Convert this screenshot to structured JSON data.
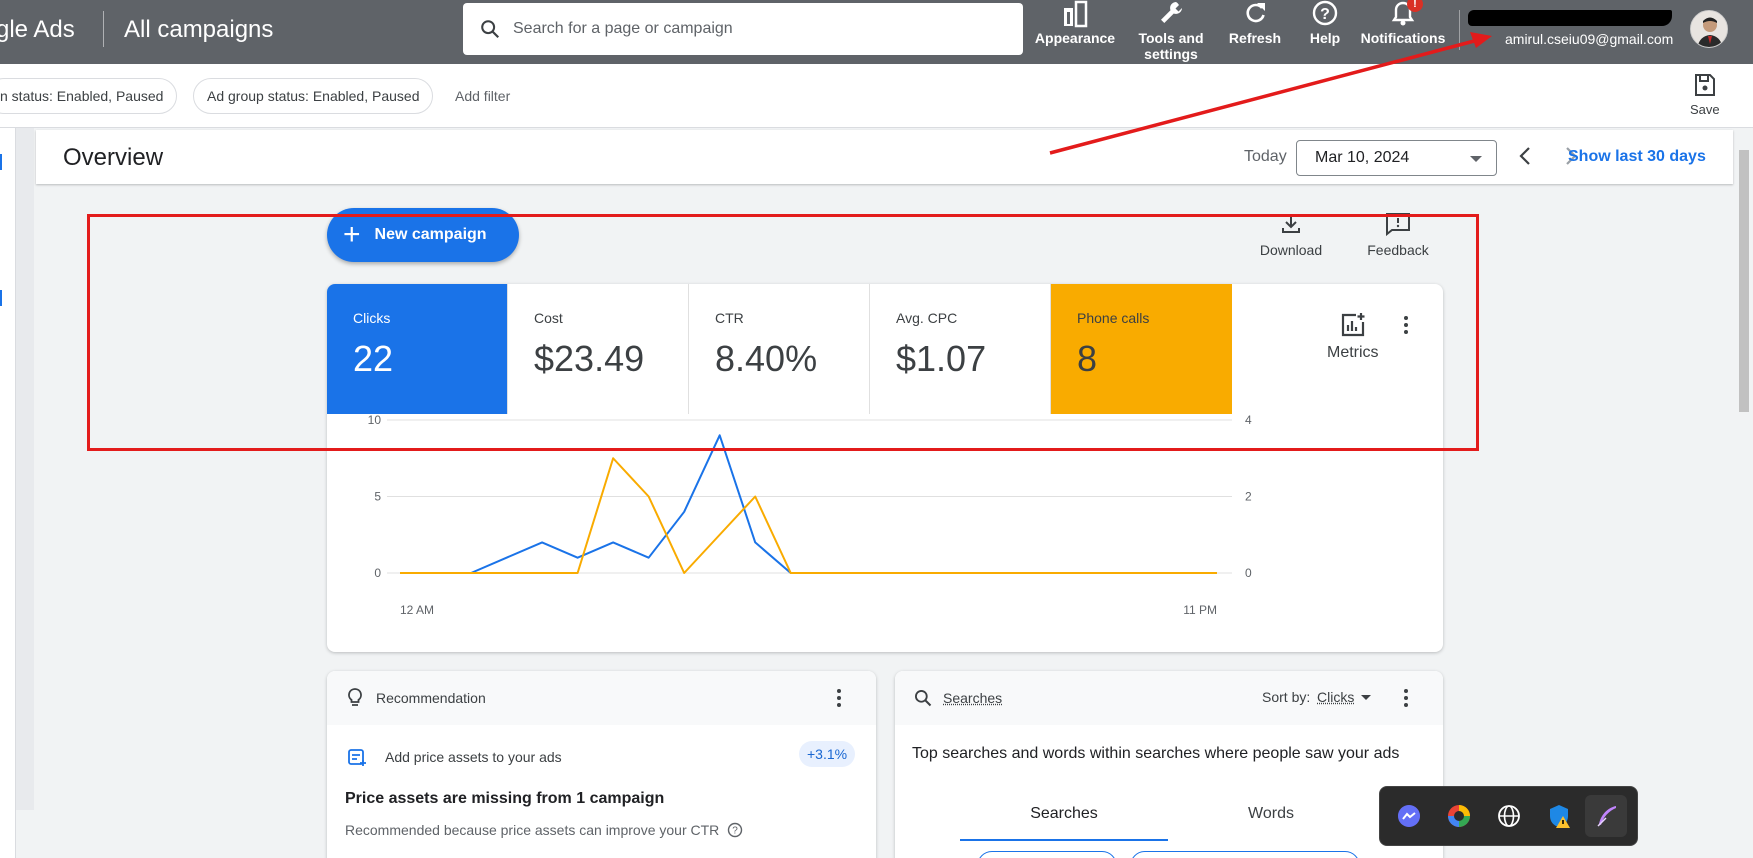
{
  "header": {
    "brand": "gle Ads",
    "page_title": "All campaigns",
    "search_placeholder": "Search for a page or campaign",
    "actions": {
      "appearance": "Appearance",
      "tools_line1": "Tools and",
      "tools_line2": "settings",
      "refresh": "Refresh",
      "help": "Help",
      "notifications": "Notifications",
      "notifications_badge": "!"
    },
    "account_email": "amirul.cseiu09@gmail.com"
  },
  "filters": {
    "chip_campaign_status": "n status: Enabled, Paused",
    "chip_ad_group_status": "Ad group status: Enabled, Paused",
    "add_filter": "Add filter",
    "save": "Save"
  },
  "overview": {
    "title": "Overview",
    "today_label": "Today",
    "date": "Mar 10, 2024",
    "show_last": "Show last 30 days"
  },
  "toolbar": {
    "new_campaign": "New campaign",
    "download": "Download",
    "feedback": "Feedback"
  },
  "metrics": {
    "clicks": {
      "label": "Clicks",
      "value": "22"
    },
    "cost": {
      "label": "Cost",
      "value": "$23.49"
    },
    "ctr": {
      "label": "CTR",
      "value": "8.40%"
    },
    "avg_cpc": {
      "label": "Avg. CPC",
      "value": "$1.07"
    },
    "phone_calls": {
      "label": "Phone calls",
      "value": "8"
    },
    "metrics_button": "Metrics"
  },
  "chart_data": {
    "type": "line",
    "x_start_label": "12 AM",
    "x_end_label": "11 PM",
    "left_axis_ticks": [
      "10",
      "5",
      "0"
    ],
    "right_axis_ticks": [
      "4",
      "2",
      "0"
    ],
    "ylim_left": [
      0,
      10
    ],
    "ylim_right": [
      0,
      4
    ],
    "grid": true,
    "series": [
      {
        "axis": "left",
        "color": "#1a73e8",
        "values": [
          0,
          0,
          0,
          1,
          2,
          1,
          2,
          1,
          4,
          9,
          2,
          0,
          0,
          0,
          0,
          0,
          0,
          0,
          0,
          0,
          0,
          0,
          0,
          0
        ]
      },
      {
        "axis": "right",
        "color": "#f9ab00",
        "values": [
          0,
          0,
          0,
          0,
          0,
          0,
          3,
          2,
          0,
          1,
          2,
          0,
          0,
          0,
          0,
          0,
          0,
          0,
          0,
          0,
          0,
          0,
          0,
          0
        ]
      }
    ]
  },
  "recommendation": {
    "title": "Recommendation",
    "item": "Add price assets to your ads",
    "badge": "+3.1%",
    "headline": "Price assets are missing from 1 campaign",
    "sub": "Recommended because price assets can improve your CTR"
  },
  "searches": {
    "title": "Searches",
    "sort_label": "Sort by:",
    "sort_value": "Clicks",
    "description": "Top searches and words within searches where people saw your ads",
    "tabs": [
      "Searches",
      "Words"
    ]
  },
  "colors": {
    "brand_blue": "#1a73e8",
    "phone_orange": "#f9ab00",
    "annotation_red": "#e31b1b",
    "topbar": "#5f6368"
  }
}
